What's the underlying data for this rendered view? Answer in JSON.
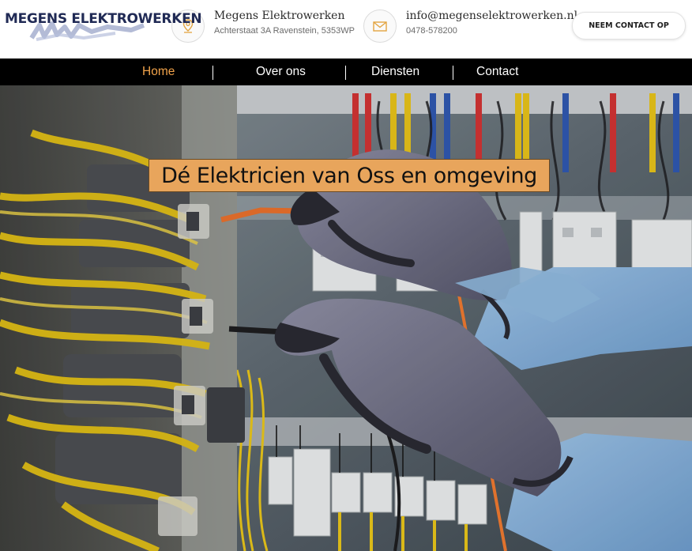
{
  "brand": {
    "logo_text": "MEGENS ELEKTROWERKEN"
  },
  "header": {
    "address": {
      "icon": "location-pin-icon",
      "title": "Megens Elektrowerken",
      "subtitle": "Achterstaat 3A Ravenstein, 5353WP"
    },
    "contact": {
      "icon": "envelope-icon",
      "email": "info@megenselektrowerken.nl",
      "phone": "0478-578200"
    },
    "cta_label": "NEEM CONTACT OP"
  },
  "nav": {
    "items": [
      {
        "label": "Home",
        "active": true
      },
      {
        "label": "Over ons",
        "active": false
      },
      {
        "label": "Diensten",
        "active": false
      },
      {
        "label": "Contact",
        "active": false
      }
    ]
  },
  "hero": {
    "headline": "Dé Elektricien van Oss en omgeving",
    "image_subject": "electrician-at-panel-photo"
  },
  "colors": {
    "accent": "#f0a24a",
    "headline_bg": "#e8a55c",
    "navbar_bg": "#000000",
    "logo_text": "#202a55"
  }
}
